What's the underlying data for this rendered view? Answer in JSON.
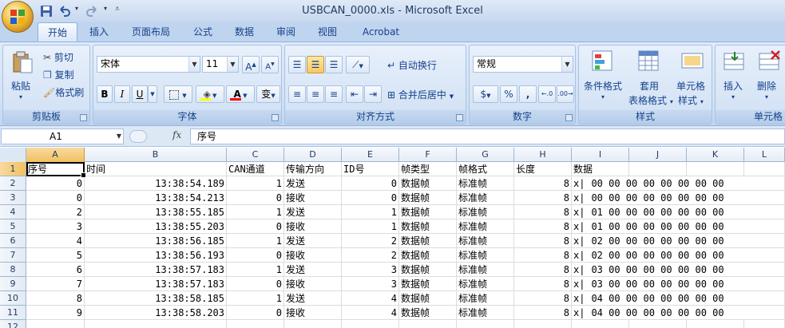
{
  "window": {
    "title": "USBCAN_0000.xls - Microsoft Excel"
  },
  "tabs": [
    "开始",
    "插入",
    "页面布局",
    "公式",
    "数据",
    "审阅",
    "视图",
    "Acrobat"
  ],
  "clipboard": {
    "paste": "粘贴",
    "cut": "剪切",
    "copy": "复制",
    "format_painter": "格式刷",
    "label": "剪贴板"
  },
  "font": {
    "name": "宋体",
    "size": "11",
    "bold": "B",
    "italic": "I",
    "underline": "U",
    "label": "字体",
    "phonetic": "变"
  },
  "alignment": {
    "wrap": "自动换行",
    "merge": "合并后居中",
    "label": "对齐方式"
  },
  "number": {
    "format": "常规",
    "percent": "%",
    "comma": ",",
    "label": "数字"
  },
  "styles": {
    "conditional": "条件格式",
    "table_1": "套用",
    "table_2": "表格格式",
    "cell_1": "单元格",
    "cell_2": "样式",
    "label": "样式"
  },
  "cells": {
    "insert": "插入",
    "delete": "删除",
    "label": "单元格"
  },
  "formula_bar": {
    "name_box": "A1",
    "fx": "fx",
    "content": "序号"
  },
  "columns": [
    "A",
    "B",
    "C",
    "D",
    "E",
    "F",
    "G",
    "H",
    "I",
    "J",
    "K",
    "L"
  ],
  "row_numbers": [
    "1",
    "2",
    "3",
    "4",
    "5",
    "6",
    "7",
    "8",
    "9",
    "10",
    "11",
    "12"
  ],
  "header_row": [
    "序号",
    "时间",
    "CAN通道",
    "传输方向",
    "ID号",
    "帧类型",
    "帧格式",
    "长度",
    "数据"
  ],
  "rows": [
    {
      "seq": "0",
      "time": "13:38:54.189",
      "ch": "1",
      "dir": "发送",
      "id": "0",
      "type": "数据帧",
      "fmt": "标准帧",
      "len": "8",
      "mark": "x|",
      "data": "00 00 00 00 00 00 00 00"
    },
    {
      "seq": "0",
      "time": "13:38:54.213",
      "ch": "0",
      "dir": "接收",
      "id": "0",
      "type": "数据帧",
      "fmt": "标准帧",
      "len": "8",
      "mark": "x|",
      "data": "00 00 00 00 00 00 00 00"
    },
    {
      "seq": "2",
      "time": "13:38:55.185",
      "ch": "1",
      "dir": "发送",
      "id": "1",
      "type": "数据帧",
      "fmt": "标准帧",
      "len": "8",
      "mark": "x|",
      "data": "01 00 00 00 00 00 00 00"
    },
    {
      "seq": "3",
      "time": "13:38:55.203",
      "ch": "0",
      "dir": "接收",
      "id": "1",
      "type": "数据帧",
      "fmt": "标准帧",
      "len": "8",
      "mark": "x|",
      "data": "01 00 00 00 00 00 00 00"
    },
    {
      "seq": "4",
      "time": "13:38:56.185",
      "ch": "1",
      "dir": "发送",
      "id": "2",
      "type": "数据帧",
      "fmt": "标准帧",
      "len": "8",
      "mark": "x|",
      "data": "02 00 00 00 00 00 00 00"
    },
    {
      "seq": "5",
      "time": "13:38:56.193",
      "ch": "0",
      "dir": "接收",
      "id": "2",
      "type": "数据帧",
      "fmt": "标准帧",
      "len": "8",
      "mark": "x|",
      "data": "02 00 00 00 00 00 00 00"
    },
    {
      "seq": "6",
      "time": "13:38:57.183",
      "ch": "1",
      "dir": "发送",
      "id": "3",
      "type": "数据帧",
      "fmt": "标准帧",
      "len": "8",
      "mark": "x|",
      "data": "03 00 00 00 00 00 00 00"
    },
    {
      "seq": "7",
      "time": "13:38:57.183",
      "ch": "0",
      "dir": "接收",
      "id": "3",
      "type": "数据帧",
      "fmt": "标准帧",
      "len": "8",
      "mark": "x|",
      "data": "03 00 00 00 00 00 00 00"
    },
    {
      "seq": "8",
      "time": "13:38:58.185",
      "ch": "1",
      "dir": "发送",
      "id": "4",
      "type": "数据帧",
      "fmt": "标准帧",
      "len": "8",
      "mark": "x|",
      "data": "04 00 00 00 00 00 00 00"
    },
    {
      "seq": "9",
      "time": "13:38:58.203",
      "ch": "0",
      "dir": "接收",
      "id": "4",
      "type": "数据帧",
      "fmt": "标准帧",
      "len": "8",
      "mark": "x|",
      "data": "04 00 00 00 00 00 00 00"
    }
  ],
  "colors": {
    "ribbon_bg": "#d2e1f4",
    "selected_header": "#f1c15f",
    "tab_text": "#15428b",
    "font_color_bar": "#ff0000",
    "highlight_bar": "#ffff00"
  }
}
